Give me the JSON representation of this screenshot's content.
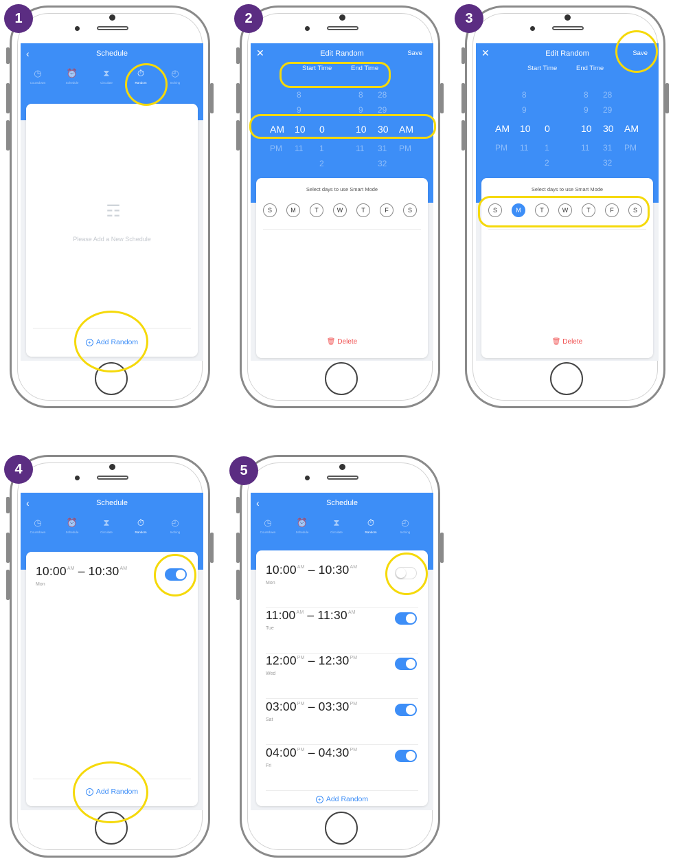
{
  "badges": [
    "1",
    "2",
    "3",
    "4",
    "5"
  ],
  "schedule_title": "Schedule",
  "edit_title": "Edit Random",
  "save_label": "Save",
  "tabs": [
    {
      "icon": "clock-icon",
      "glyph": "◷",
      "label": "Countdown"
    },
    {
      "icon": "alarm-icon",
      "glyph": "⏰",
      "label": "Schedule"
    },
    {
      "icon": "hourglass-icon",
      "glyph": "⧗",
      "label": "Circulate"
    },
    {
      "icon": "stopwatch-icon",
      "glyph": "⏱",
      "label": "Random"
    },
    {
      "icon": "history-icon",
      "glyph": "◴",
      "label": "Inching"
    }
  ],
  "empty_text": "Please Add a New Schedule",
  "add_random": "Add Random",
  "start_time": "Start Time",
  "end_time": "End Time",
  "picker": {
    "above": [
      "8",
      "",
      "8",
      "28"
    ],
    "prev": [
      "9",
      "",
      "9",
      "29"
    ],
    "selected": [
      "AM",
      "10",
      "0",
      "10",
      "30",
      "AM"
    ],
    "next": [
      "PM",
      "11",
      "1",
      "11",
      "31",
      "PM"
    ],
    "below": [
      "2",
      "",
      "2",
      "32"
    ]
  },
  "select_days": "Select days to use Smart Mode",
  "days": [
    "S",
    "M",
    "T",
    "W",
    "T",
    "F",
    "S"
  ],
  "delete_label": "Delete",
  "accent": "#3d8ef7",
  "highlight": "#f5d90a",
  "badge_color": "#5b2d82",
  "rows4": [
    {
      "start": "10:00",
      "sa": "AM",
      "end": "10:30",
      "ea": "AM",
      "day": "Mon",
      "on": true
    }
  ],
  "rows5": [
    {
      "start": "10:00",
      "sa": "AM",
      "end": "10:30",
      "ea": "AM",
      "day": "Mon",
      "on": false
    },
    {
      "start": "11:00",
      "sa": "AM",
      "end": "11:30",
      "ea": "AM",
      "day": "Tue",
      "on": true
    },
    {
      "start": "12:00",
      "sa": "PM",
      "end": "12:30",
      "ea": "PM",
      "day": "Wed",
      "on": true
    },
    {
      "start": "03:00",
      "sa": "PM",
      "end": "03:30",
      "ea": "PM",
      "day": "Sat",
      "on": true
    },
    {
      "start": "04:00",
      "sa": "PM",
      "end": "04:30",
      "ea": "PM",
      "day": "Fri",
      "on": true
    }
  ]
}
